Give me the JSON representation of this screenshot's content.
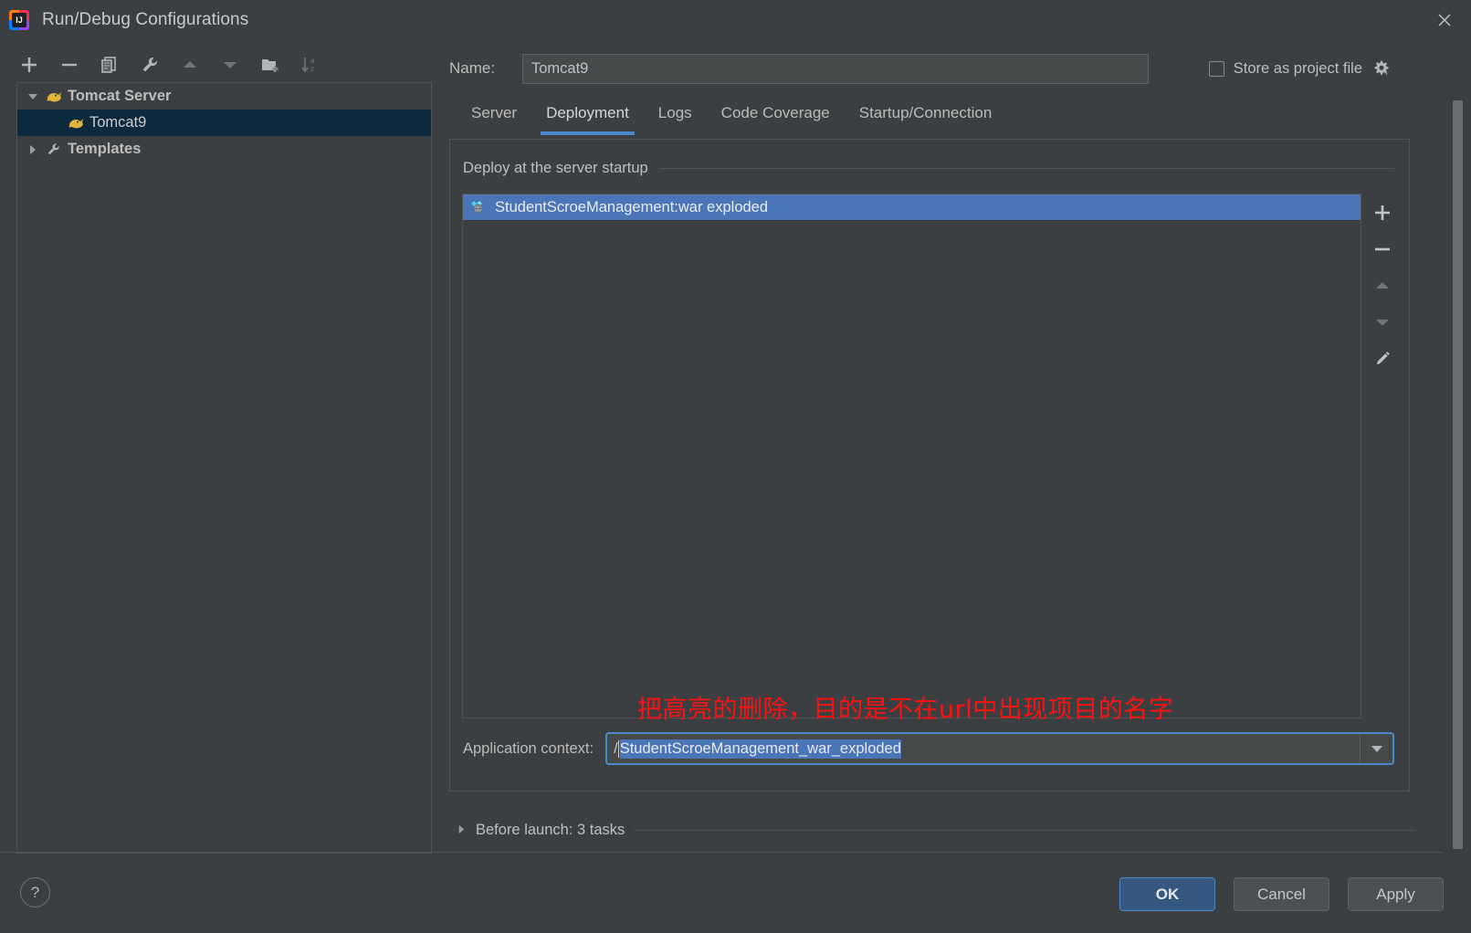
{
  "window": {
    "title": "Run/Debug Configurations",
    "app_icon": "intellij-idea-icon",
    "close_icon": "close-icon"
  },
  "left_toolbar": {
    "items": [
      {
        "name": "add-configuration-button",
        "icon": "plus-icon",
        "enabled": true
      },
      {
        "name": "remove-configuration-button",
        "icon": "minus-icon",
        "enabled": true
      },
      {
        "name": "copy-configuration-button",
        "icon": "copy-icon",
        "enabled": true
      },
      {
        "name": "edit-templates-button",
        "icon": "wrench-icon",
        "enabled": true
      },
      {
        "name": "move-up-button",
        "icon": "arrow-up-icon",
        "enabled": false
      },
      {
        "name": "move-down-button",
        "icon": "arrow-down-icon",
        "enabled": false
      },
      {
        "name": "new-folder-button",
        "icon": "folder-add-icon",
        "enabled": true
      },
      {
        "name": "sort-configurations-button",
        "icon": "sort-az-icon",
        "enabled": false
      }
    ]
  },
  "tree": {
    "nodes": [
      {
        "label": "Tomcat Server",
        "icon": "tomcat-icon",
        "twisty": "expanded",
        "selected": false,
        "level": 0
      },
      {
        "label": "Tomcat9",
        "icon": "tomcat-icon",
        "twisty": "none",
        "selected": true,
        "level": 1
      },
      {
        "label": "Templates",
        "icon": "wrench-icon",
        "twisty": "collapsed",
        "selected": false,
        "level": 0
      }
    ]
  },
  "help": {
    "label": "?"
  },
  "name_row": {
    "label": "Name:",
    "value": "Tomcat9",
    "placeholder": ""
  },
  "store_as_project_file": {
    "label": "Store as project file",
    "checked": false,
    "gear_icon": "gear-dropdown-icon"
  },
  "tabs": [
    {
      "label": "Server",
      "active": false
    },
    {
      "label": "Deployment",
      "active": true
    },
    {
      "label": "Logs",
      "active": false
    },
    {
      "label": "Code Coverage",
      "active": false
    },
    {
      "label": "Startup/Connection",
      "active": false
    }
  ],
  "deployment": {
    "group_title": "Deploy at the server startup",
    "items": [
      {
        "label": "StudentScroeManagement:war exploded",
        "icon": "artifact-icon",
        "selected": true
      }
    ],
    "list_toolbar": [
      {
        "name": "add-artifact-button",
        "icon": "plus-icon",
        "enabled": true
      },
      {
        "name": "remove-artifact-button",
        "icon": "minus-icon",
        "enabled": true
      },
      {
        "name": "move-artifact-up-button",
        "icon": "arrow-up-icon",
        "enabled": false
      },
      {
        "name": "move-artifact-down-button",
        "icon": "arrow-down-icon",
        "enabled": false
      },
      {
        "name": "edit-artifact-button",
        "icon": "pencil-icon",
        "enabled": true
      }
    ],
    "annotation": "把高亮的删除，目的是不在url中出现项目的名字",
    "application_context": {
      "label": "Application context:",
      "prefix": "/",
      "selected_text": "StudentScroeManagement_war_exploded",
      "full_value": "/StudentScroeManagement_war_exploded",
      "dropdown_icon": "chevron-down-icon"
    }
  },
  "before_launch": {
    "label": "Before launch: 3 tasks",
    "twisty": "collapsed"
  },
  "footer": {
    "ok_label": "OK",
    "cancel_label": "Cancel",
    "apply_label": "Apply"
  },
  "colors": {
    "background": "#3c3f41",
    "selection_blue": "#4a76b8",
    "accent_blue": "#4a88c7",
    "tree_selection": "#0d293e",
    "annotation_red": "#ff1010",
    "primary_button": "#365880"
  }
}
